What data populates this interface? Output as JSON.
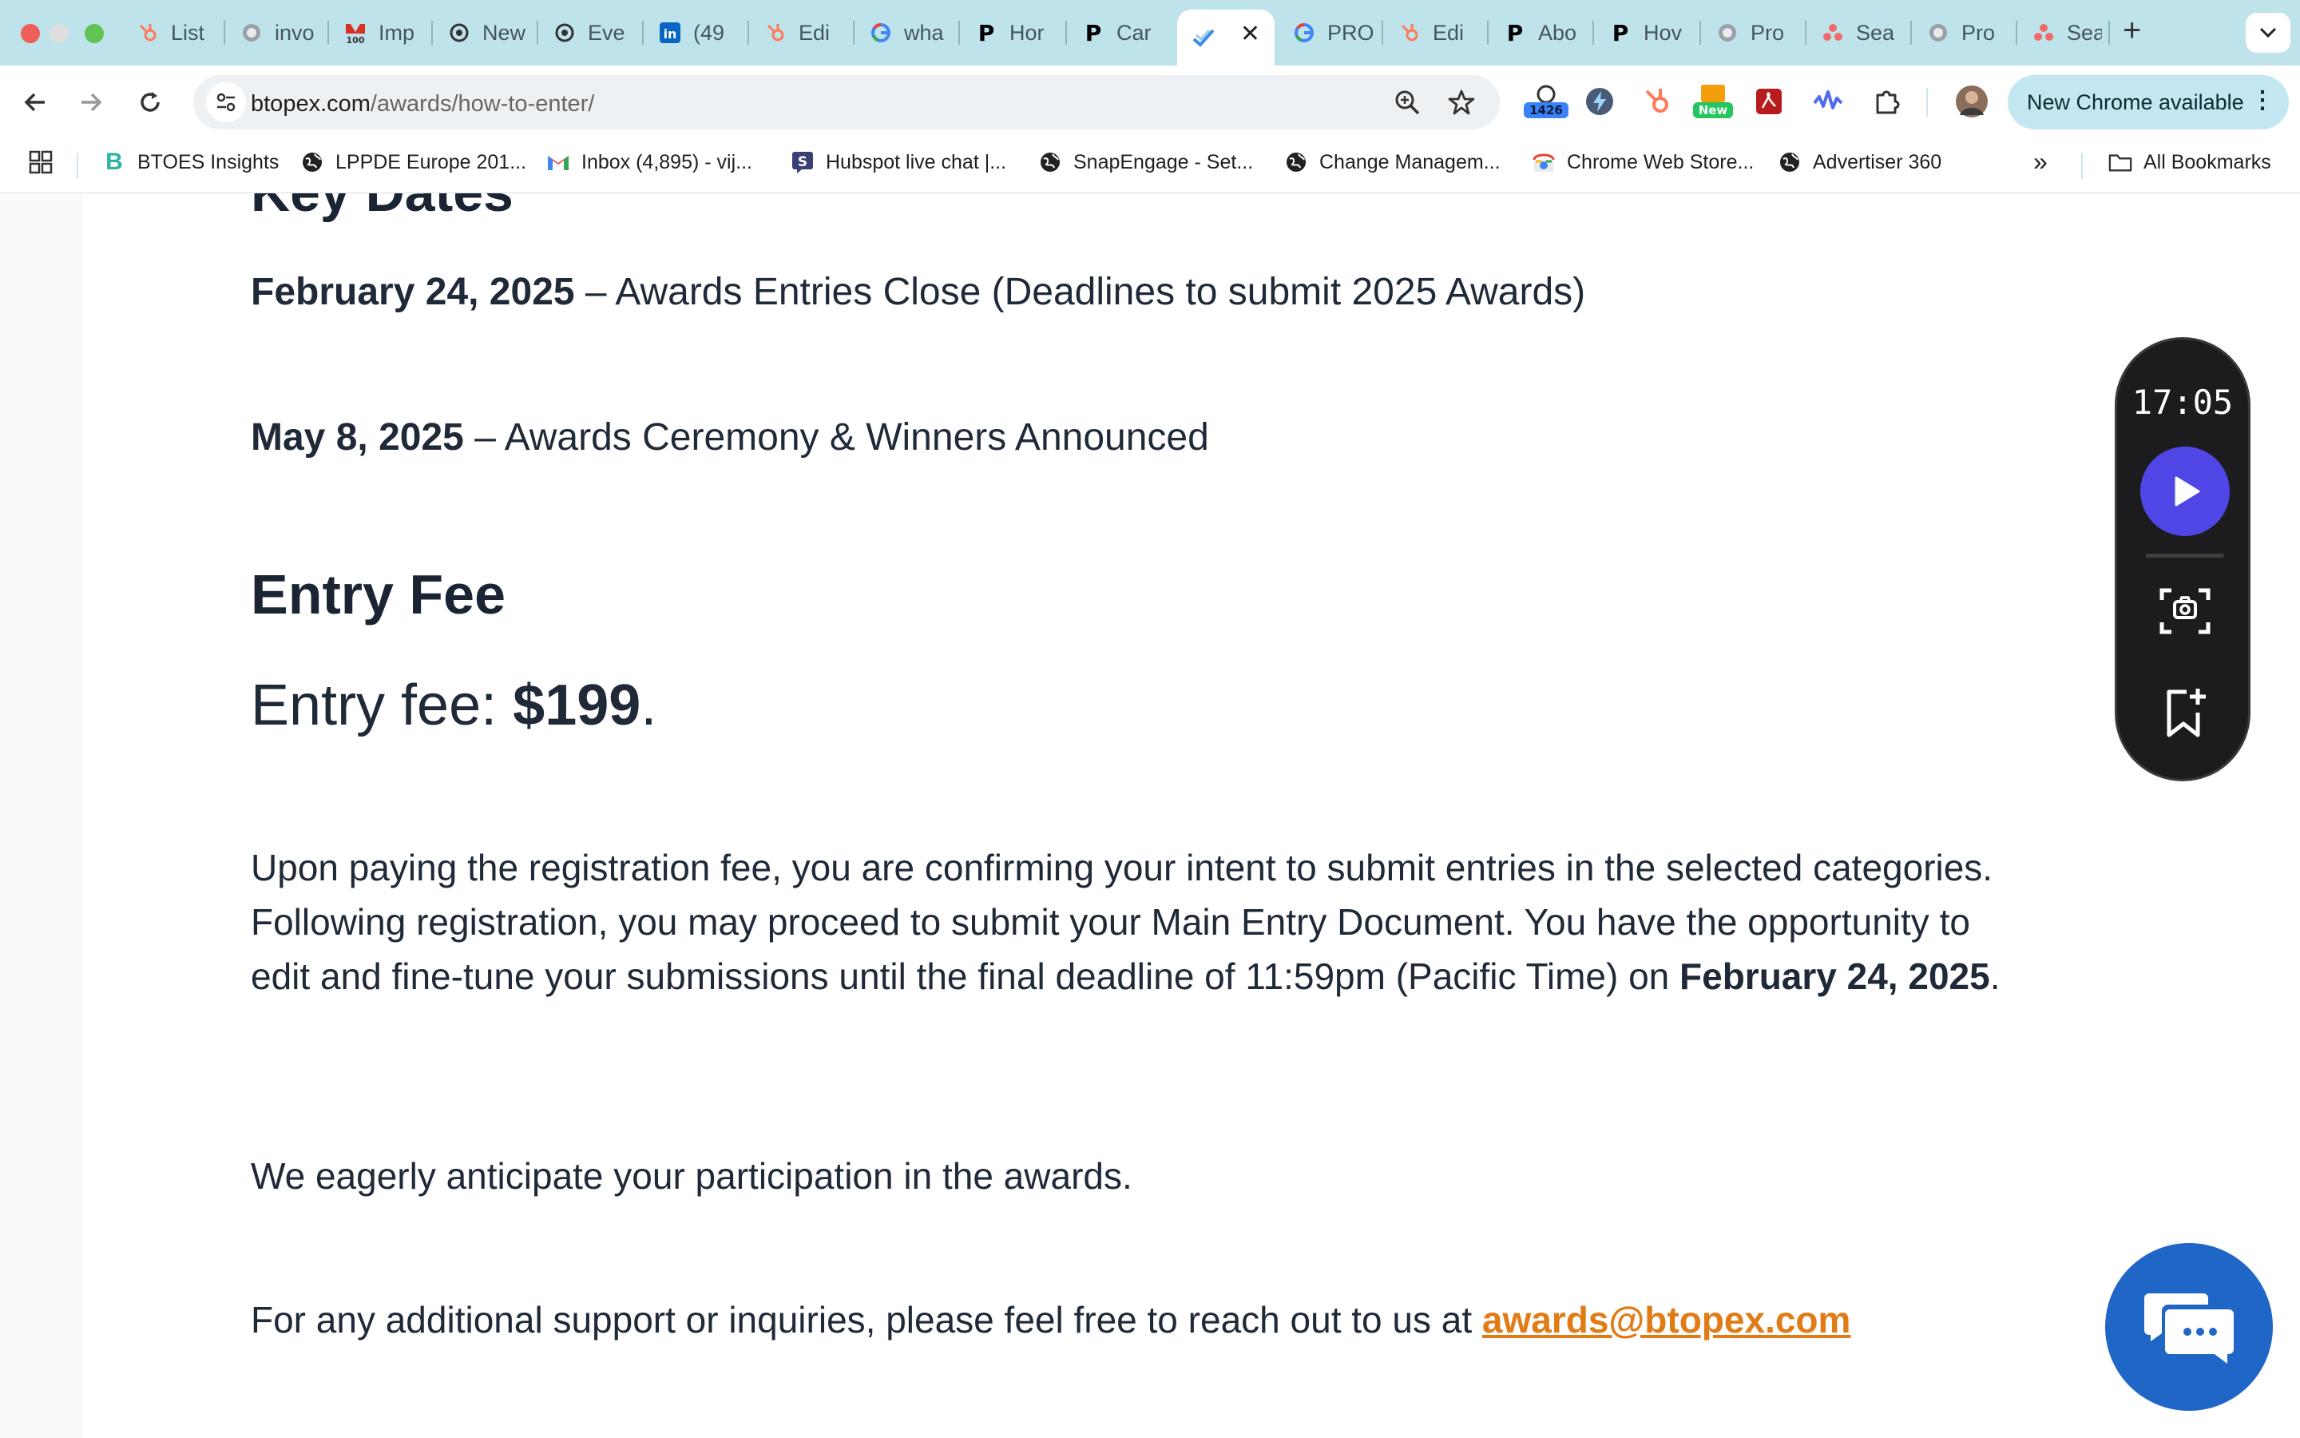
{
  "browser": {
    "tabs": [
      {
        "title": "List",
        "icon": "hubspot-icon"
      },
      {
        "title": "invo",
        "icon": "globe-icon"
      },
      {
        "title": "Imp",
        "icon": "btoes-100-icon"
      },
      {
        "title": "New",
        "icon": "chatgpt-icon"
      },
      {
        "title": "Eve",
        "icon": "chatgpt-icon"
      },
      {
        "title": "(49",
        "icon": "linkedin-icon"
      },
      {
        "title": "Edi",
        "icon": "hubspot-icon"
      },
      {
        "title": "wha",
        "icon": "google-icon"
      },
      {
        "title": "Hor",
        "icon": "p-logo-icon"
      },
      {
        "title": "Car",
        "icon": "p-logo-icon"
      },
      {
        "title": "",
        "icon": "btopex-icon",
        "active": true
      },
      {
        "title": "PRO",
        "icon": "google-icon"
      },
      {
        "title": "Edi",
        "icon": "hubspot-icon"
      },
      {
        "title": "Abo",
        "icon": "p-logo-icon"
      },
      {
        "title": "Hov",
        "icon": "p-logo-icon"
      },
      {
        "title": "Pro",
        "icon": "globe-icon"
      },
      {
        "title": "Sea",
        "icon": "asana-icon"
      },
      {
        "title": "Pro",
        "icon": "globe-icon"
      },
      {
        "title": "Sea",
        "icon": "asana-icon"
      }
    ],
    "url_domain": "btopex.com",
    "url_path": "/awards/how-to-enter/",
    "extension_badge": "1426",
    "new_badge": "New",
    "update_button": "New Chrome available",
    "bookmarks": [
      {
        "label": "BTOES Insights",
        "icon": "btoes-icon"
      },
      {
        "label": "LPPDE Europe 201...",
        "icon": "globe-icon"
      },
      {
        "label": "Inbox (4,895) - vij...",
        "icon": "gmail-icon"
      },
      {
        "label": "Hubspot live chat |...",
        "icon": "snapengage-icon"
      },
      {
        "label": "SnapEngage - Set...",
        "icon": "globe-icon"
      },
      {
        "label": "Change Managem...",
        "icon": "globe-icon"
      },
      {
        "label": "Chrome Web Store...",
        "icon": "chrome-web-store-icon"
      },
      {
        "label": "Advertiser 360",
        "icon": "globe-icon"
      }
    ],
    "all_bookmarks": "All Bookmarks"
  },
  "page": {
    "key_dates_heading": "Key Dates",
    "dates": [
      {
        "date": "February 24, 2025",
        "text": " – Awards Entries Close (Deadlines to submit 2025 Awards)"
      },
      {
        "date": "May 8, 2025",
        "text": " – Awards Ceremony & Winners Announced"
      }
    ],
    "entry_fee_heading": "Entry Fee",
    "fee_label": "Entry fee: ",
    "fee_amount": "$199",
    "fee_suffix": ".",
    "registration_para": "Upon paying the registration fee, you are confirming your intent to submit entries in the selected categories. Following registration, you may proceed to submit your Main Entry Document. You have the opportunity to edit and fine-tune your submissions until the final deadline of 11:59pm (Pacific Time) on ",
    "registration_deadline": "February 24, 2025",
    "registration_suffix": ".",
    "anticipate_para": "We eagerly anticipate your participation in the awards.",
    "support_para": "For any additional support or inquiries, please feel free to reach out to us at ",
    "support_email": "awards@btopex.com"
  },
  "recorder": {
    "time": "17:05"
  },
  "colors": {
    "tab_strip": "#bfe3ea",
    "link_orange": "#e07b16",
    "recorder_play": "#4f46e5",
    "chat_blue": "#1f66c7"
  }
}
